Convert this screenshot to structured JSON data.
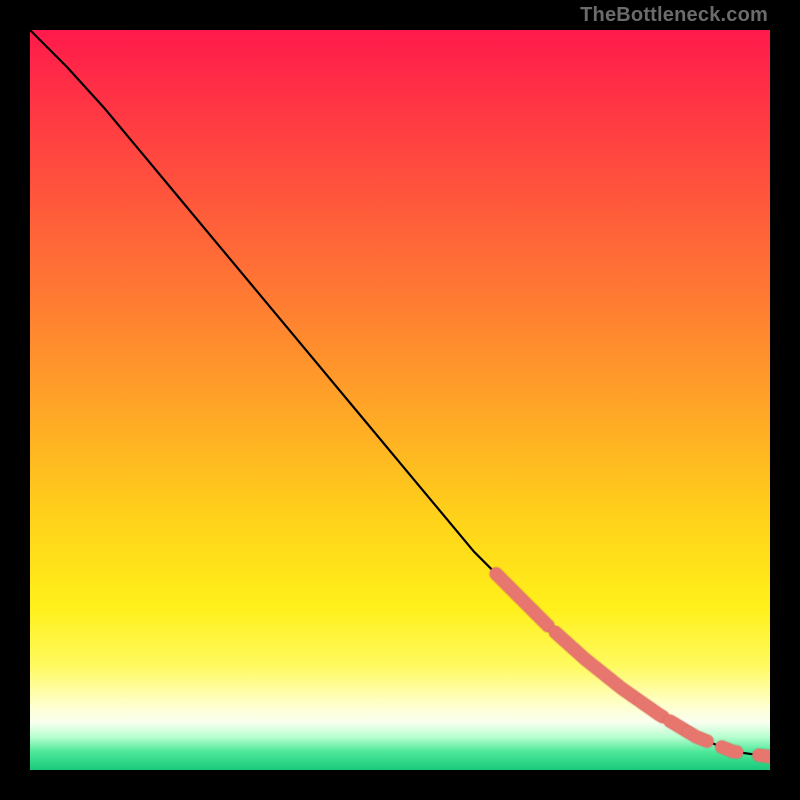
{
  "watermark": "TheBottleneck.com",
  "colors": {
    "frame": "#000000",
    "curve": "#000000",
    "marker_fill": "#e7776e",
    "marker_stroke": "#c95c54",
    "gradient_stops": [
      {
        "offset": 0.0,
        "color": "#ff1a4b"
      },
      {
        "offset": 0.18,
        "color": "#ff4a3f"
      },
      {
        "offset": 0.36,
        "color": "#ff7a33"
      },
      {
        "offset": 0.52,
        "color": "#ffa826"
      },
      {
        "offset": 0.66,
        "color": "#ffd21a"
      },
      {
        "offset": 0.78,
        "color": "#fff01a"
      },
      {
        "offset": 0.86,
        "color": "#fffa60"
      },
      {
        "offset": 0.905,
        "color": "#ffffbf"
      },
      {
        "offset": 0.935,
        "color": "#fafff0"
      },
      {
        "offset": 0.955,
        "color": "#b8ffd0"
      },
      {
        "offset": 0.975,
        "color": "#4fe89a"
      },
      {
        "offset": 1.0,
        "color": "#18c97a"
      }
    ]
  },
  "chart_data": {
    "type": "line",
    "title": "",
    "xlabel": "",
    "ylabel": "",
    "xlim": [
      0,
      100
    ],
    "ylim": [
      0,
      100
    ],
    "grid": false,
    "legend": false,
    "series": [
      {
        "name": "curve",
        "x": [
          0,
          5,
          10,
          15,
          20,
          25,
          30,
          35,
          40,
          45,
          50,
          55,
          60,
          65,
          70,
          75,
          80,
          85,
          90,
          95,
          100
        ],
        "y": [
          100,
          95,
          89.5,
          83.5,
          77.5,
          71.5,
          65.5,
          59.5,
          53.5,
          47.5,
          41.5,
          35.5,
          29.5,
          24.5,
          19.5,
          15,
          11,
          7.5,
          4.5,
          2.5,
          1.8
        ]
      },
      {
        "name": "highlight-segments",
        "note": "approximate x-ranges of the thick salmon overlay segments along the curve",
        "ranges": [
          [
            63,
            70
          ],
          [
            71,
            82
          ],
          [
            82.5,
            85.5
          ],
          [
            86.5,
            88.5
          ],
          [
            89,
            91.5
          ],
          [
            93.5,
            95.5
          ],
          [
            98.5,
            100
          ]
        ]
      }
    ]
  }
}
